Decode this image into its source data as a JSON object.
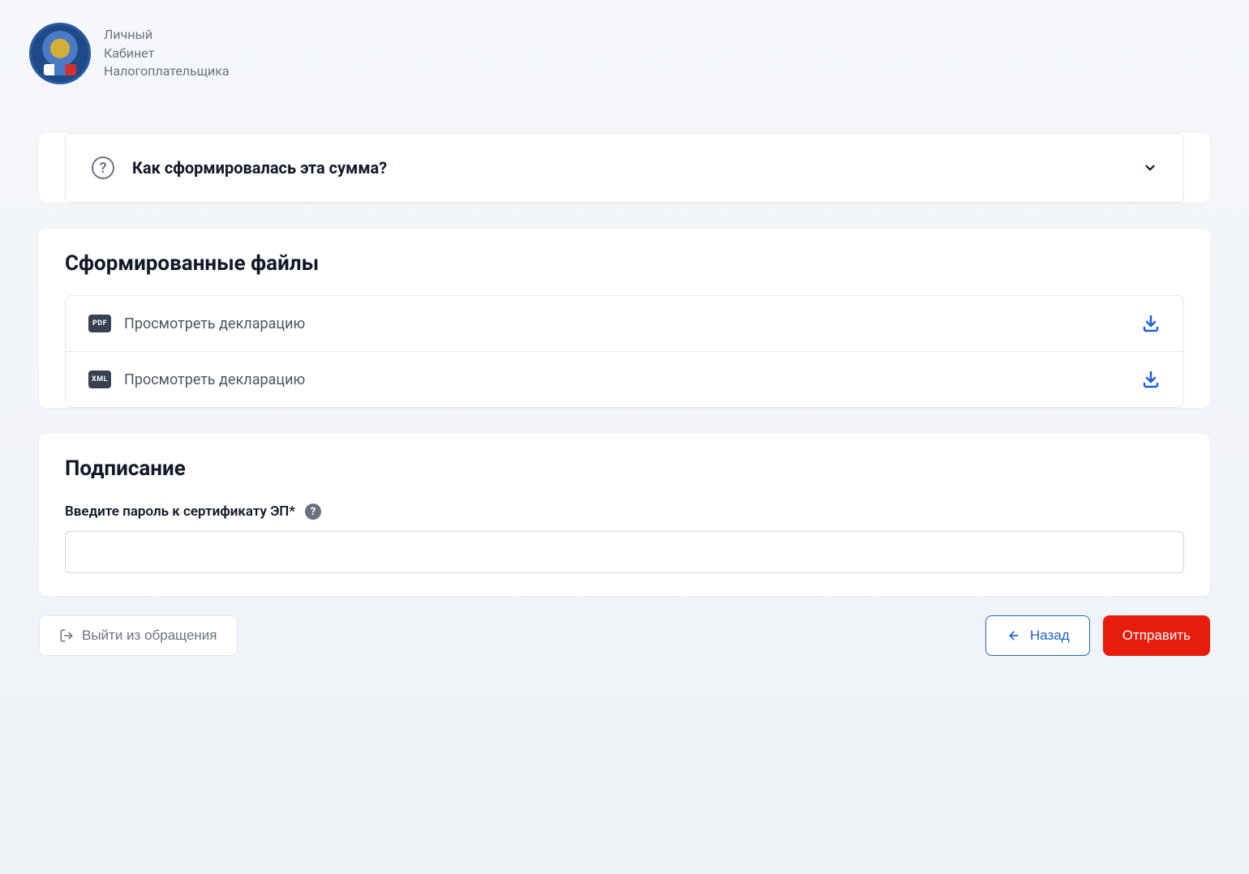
{
  "header": {
    "line1": "Личный",
    "line2": "Кабинет",
    "line3": "Налогоплательщика"
  },
  "accordion": {
    "title": "Как сформировалась эта сумма?"
  },
  "files": {
    "section_title": "Сформированные файлы",
    "items": [
      {
        "badge": "PDF",
        "label": "Просмотреть декларацию"
      },
      {
        "badge": "XML",
        "label": "Просмотреть декларацию"
      }
    ]
  },
  "signing": {
    "section_title": "Подписание",
    "field_label": "Введите пароль к сертификату ЭП*"
  },
  "actions": {
    "exit_label": "Выйти из обращения",
    "back_label": "Назад",
    "submit_label": "Отправить"
  }
}
